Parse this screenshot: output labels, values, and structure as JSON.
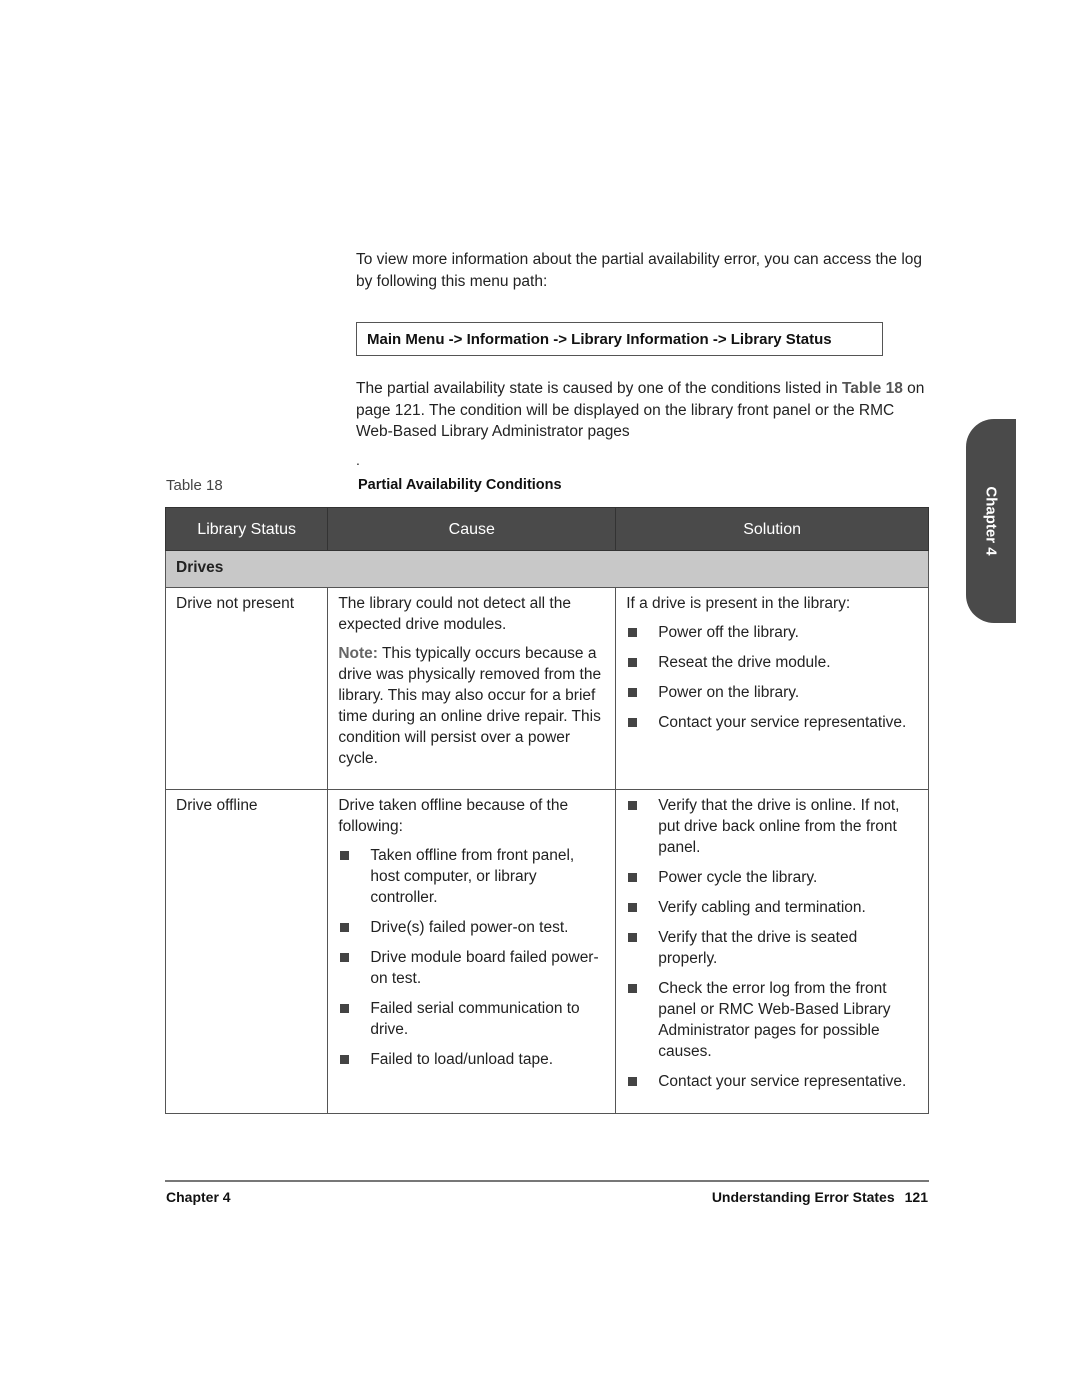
{
  "intro_paragraph": "To view more information about the partial availability error, you can access the log by following this menu path:",
  "menu_path": "Main Menu -> Information -> Library Information -> Library Status",
  "condition_paragraph": {
    "before": "The partial availability state is caused by one of the conditions listed in ",
    "xref": "Table 18",
    "after": " on page 121. The condition will be displayed on the library front panel or the RMC Web-Based Library Administrator pages"
  },
  "stray_period": ".",
  "table": {
    "label": "Table 18",
    "title": "Partial Availability Conditions",
    "headers": [
      "Library Status",
      "Cause",
      "Solution"
    ],
    "group": "Drives",
    "rows": [
      {
        "status": "Drive not present",
        "cause_text": "The library could not detect all the expected drive modules.",
        "cause_note_label": "Note:",
        "cause_note": " This typically occurs because a drive was physically removed from the library. This may also occur for a brief time during an online drive repair. This condition will persist over a power cycle.",
        "cause_bullets": [],
        "solution_intro": "If a drive is present in the library:",
        "solution_bullets": [
          "Power off the library.",
          "Reseat the drive module.",
          "Power on the library.",
          "Contact your service representative."
        ]
      },
      {
        "status": "Drive offline",
        "cause_text": "Drive taken offline because of the following:",
        "cause_bullets": [
          "Taken offline from front panel, host computer, or library controller.",
          "Drive(s) failed power-on test.",
          "Drive module board failed power-on test.",
          "Failed serial communication to drive.",
          "Failed to load/unload tape."
        ],
        "solution_bullets": [
          "Verify that the drive is online. If not, put drive back online from the front panel.",
          "Power cycle the library.",
          "Verify cabling and termination.",
          "Verify that the drive is seated properly.",
          "Check the error log from the front panel or RMC Web-Based Library Administrator pages for possible causes.",
          "Contact your service representative."
        ]
      }
    ]
  },
  "side_tab": "Chapter 4",
  "footer": {
    "chapter": "Chapter 4",
    "section": "Understanding Error States",
    "page": "121"
  }
}
